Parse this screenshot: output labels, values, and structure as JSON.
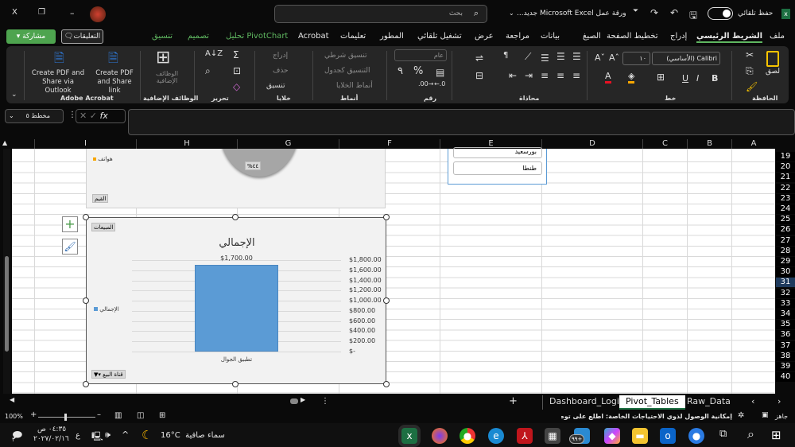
{
  "titlebar": {
    "autosave_label": "حفظ تلقائي",
    "autosave_on": true,
    "document_title": "ورقة عمل Microsoft Excel جديد...",
    "search_placeholder": "بحث",
    "minimize": "–",
    "restore": "❐",
    "close": "X"
  },
  "ribbon_tabs": [
    {
      "label": "ملف"
    },
    {
      "label": "الشريط الرئيسي",
      "active": true
    },
    {
      "label": "إدراج"
    },
    {
      "label": "تخطيط الصفحة"
    },
    {
      "label": "الصيغ"
    },
    {
      "label": "بيانات"
    },
    {
      "label": "مراجعة"
    },
    {
      "label": "عرض"
    },
    {
      "label": "تشغيل تلقائي"
    },
    {
      "label": "المطور"
    },
    {
      "label": "تعليمات"
    },
    {
      "label": "Acrobat"
    },
    {
      "label": "تحليل PivotChart",
      "contextual": true
    },
    {
      "label": "تصميم",
      "contextual": true
    },
    {
      "label": "تنسيق",
      "contextual": true
    }
  ],
  "comments_button": "التعليقات",
  "share_button": "مشاركة",
  "ribbon": {
    "clipboard": {
      "label": "الحافظة",
      "paste": "لصق"
    },
    "font": {
      "label": "خط",
      "font_name": "Calibri (الأساسي)",
      "font_size": "١٠",
      "bold": "B",
      "italic": "I",
      "underline": "U",
      "font_color": "#e81123",
      "fill_color": "#f7a600"
    },
    "alignment": {
      "label": "محاذاة"
    },
    "number": {
      "label": "رقم",
      "format": "عام",
      "percent": "%",
      "comma": "٩"
    },
    "styles": {
      "label": "أنماط",
      "conditional": "تنسيق شرطي",
      "as_table": "التنسيق كجدول",
      "cell_styles": "أنماط الخلايا"
    },
    "cells": {
      "label": "خلايا",
      "insert": "إدراج",
      "delete": "حذف",
      "format": "تنسيق"
    },
    "editing": {
      "label": "تحرير"
    },
    "addins": {
      "label": "الوظائف الإضافية",
      "button": "الوظائف الإضافية"
    },
    "acrobat": {
      "label": "Adobe Acrobat",
      "share_link": "Create PDF and Share link",
      "share_outlook": "Create PDF and Share via Outlook"
    }
  },
  "formula_bar": {
    "name_box": "مخطط ٥",
    "fx": "fx",
    "value": ""
  },
  "columns": [
    "I",
    "H",
    "G",
    "F",
    "E",
    "D",
    "C",
    "B",
    "A"
  ],
  "rows": [
    "19",
    "20",
    "21",
    "22",
    "23",
    "24",
    "25",
    "26",
    "27",
    "28",
    "29",
    "30",
    "31",
    "32",
    "33",
    "34",
    "35",
    "36",
    "37",
    "38",
    "39",
    "40"
  ],
  "selected_row": "31",
  "slicer": {
    "items": [
      "بورسعيد",
      "طنطا"
    ]
  },
  "pie_chart": {
    "legend_item": "هواتف",
    "data_label": "%٤٤",
    "field_button": "القيم",
    "legend_color": "#f7a600"
  },
  "chart_data": {
    "type": "bar",
    "title": "الإجمالي",
    "categories": [
      "تطبيق الجوال"
    ],
    "series": [
      {
        "name": "الإجمالي",
        "values": [
          1700
        ],
        "color": "#5b9bd5"
      }
    ],
    "data_labels": [
      "$1,700.00"
    ],
    "ylim": [
      0,
      1800
    ],
    "yticks": [
      "$-",
      "$200.00",
      "$400.00",
      "$600.00",
      "$800.00",
      "$1,000.00",
      "$1,200.00",
      "$1,400.00",
      "$1,600.00",
      "$1,800.00"
    ],
    "ytick_values": [
      0,
      200,
      400,
      600,
      800,
      1000,
      1200,
      1400,
      1600,
      1800
    ],
    "grid": true,
    "legend": "left",
    "value_field_button": "المبيعات",
    "axis_field_button": "قناة البيع"
  },
  "sheets": [
    {
      "label": "Raw_Data"
    },
    {
      "label": "Pivot_Tables",
      "active": true
    },
    {
      "label": "Dashboard_Logic"
    }
  ],
  "add_sheet": "+",
  "status": {
    "ready": "جاهز",
    "accessibility": "إمكانية الوصول لذوي الاحتياجات الخاصة: اطلع على توصيات",
    "zoom": "100%"
  },
  "taskbar": {
    "weather": "سماء صافية",
    "temp": "16°C",
    "time": "٠٤:٣٥ ص",
    "date": "٢٠٢٧/٠٢/١٦",
    "lang": "ع",
    "notification_count": "٢",
    "store_badge": "٩٩+"
  }
}
